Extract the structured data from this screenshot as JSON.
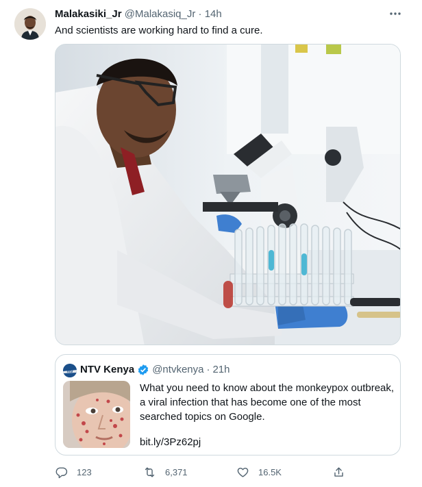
{
  "tweet": {
    "author_name": "Malakasiki_Jr",
    "author_handle": "@Malakasiq_Jr",
    "separator": "·",
    "time": "14h",
    "text": "And scientists are working hard to find a cure."
  },
  "quoted": {
    "author_name": "NTV Kenya",
    "author_handle": "@ntvkenya",
    "separator": "·",
    "time": "21h",
    "text": "What you need to know about the monkeypox outbreak, a viral infection that has become one of the most searched topics on Google.",
    "link": "bit.ly/3Pz62pj",
    "logo_text": "ntv"
  },
  "actions": {
    "replies": "123",
    "retweets": "6,371",
    "likes": "16.5K"
  },
  "icons": {
    "more": "more-dots-icon",
    "reply": "reply-icon",
    "retweet": "retweet-icon",
    "like": "heart-icon",
    "share": "share-icon",
    "verified": "verified-badge-icon"
  },
  "colors": {
    "text": "#0f1419",
    "secondary": "#536471",
    "border": "#cfd9de",
    "verified": "#1d9bf0"
  }
}
